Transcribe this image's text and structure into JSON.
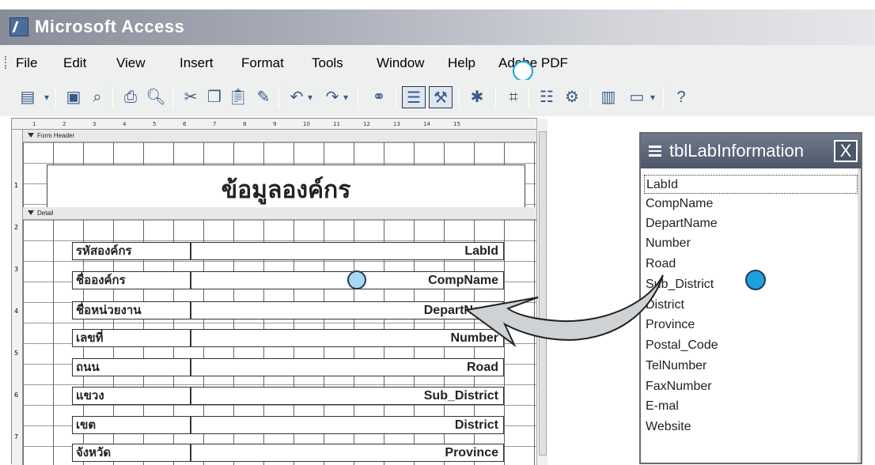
{
  "window": {
    "title": "Microsoft Access"
  },
  "menu": [
    "File",
    "Edit",
    "View",
    "Insert",
    "Format",
    "Tools",
    "Window",
    "Help",
    "Adobe PDF"
  ],
  "ruler": {
    "marks": [
      "1",
      "2",
      "3",
      "4",
      "5",
      "6",
      "7",
      "8",
      "9",
      "10",
      "11",
      "12",
      "13",
      "14",
      "15"
    ],
    "vmarks": [
      "1",
      "2",
      "3",
      "4",
      "5",
      "6",
      "7"
    ]
  },
  "form": {
    "header_section": "Form Header",
    "detail_section": "Detail",
    "title": "ข้อมูลองค์กร",
    "rows": [
      {
        "label": "รหัสองค์กร",
        "field": "LabId"
      },
      {
        "label": "ชื่อองค์กร",
        "field": "CompName"
      },
      {
        "label": "ชื่อหน่วยงาน",
        "field": "DepartName"
      },
      {
        "label": "เลขที่",
        "field": "Number"
      },
      {
        "label": "ถนน",
        "field": "Road"
      },
      {
        "label": "แขวง",
        "field": "Sub_District"
      },
      {
        "label": "เขต",
        "field": "District"
      },
      {
        "label": "จังหวัด",
        "field": "Province"
      }
    ]
  },
  "field_list": {
    "title": "tblLabInformation",
    "close_glyph": "X",
    "items": [
      "LabId",
      "CompName",
      "DepartName",
      "Number",
      "Road",
      "Sub_District",
      "District",
      "Province",
      "Postal_Code",
      "TelNumber",
      "FaxNumber",
      "E-mal",
      "Website"
    ]
  },
  "icons": [
    "form-view-icon",
    "save-icon",
    "search-icon",
    "print-icon",
    "print-preview-icon",
    "cut-icon",
    "copy-icon",
    "paste-icon",
    "format-painter-icon",
    "undo-icon",
    "redo-icon",
    "hyperlink-icon",
    "field-list-icon",
    "toolbox-icon",
    "autoformat-icon",
    "code-icon",
    "properties-icon",
    "build-icon",
    "database-window-icon",
    "new-object-icon",
    "help-icon"
  ],
  "colors": {
    "title_gradient_start": "#888c98",
    "field_list_title": "#4d5769",
    "dot_fill": "#1fa0e0",
    "dot_light": "#a8d8f0"
  }
}
